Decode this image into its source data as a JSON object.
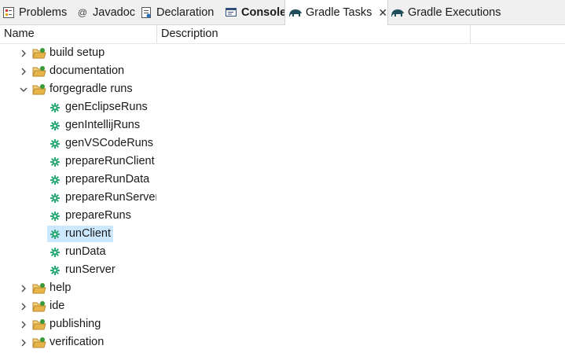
{
  "tabs": [
    {
      "label": "Problems"
    },
    {
      "label": "Javadoc"
    },
    {
      "label": "Declaration"
    },
    {
      "label": "Console"
    },
    {
      "label": "Gradle Tasks"
    },
    {
      "label": "Gradle Executions"
    }
  ],
  "columns": {
    "name": "Name",
    "description": "Description"
  },
  "tree": {
    "build_setup": "build setup",
    "documentation": "documentation",
    "forgegradle_runs": "forgegradle runs",
    "tasks": [
      "genEclipseRuns",
      "genIntellijRuns",
      "genVSCodeRuns",
      "prepareRunClient",
      "prepareRunData",
      "prepareRunServer",
      "prepareRuns",
      "runClient",
      "runData",
      "runServer"
    ],
    "help": "help",
    "ide": "ide",
    "publishing": "publishing",
    "verification": "verification"
  },
  "colors": {
    "selection": "#cce8ff",
    "gear": "#2aa876",
    "folder": "#e8b54a",
    "folder_badge": "#3a9a3a"
  }
}
